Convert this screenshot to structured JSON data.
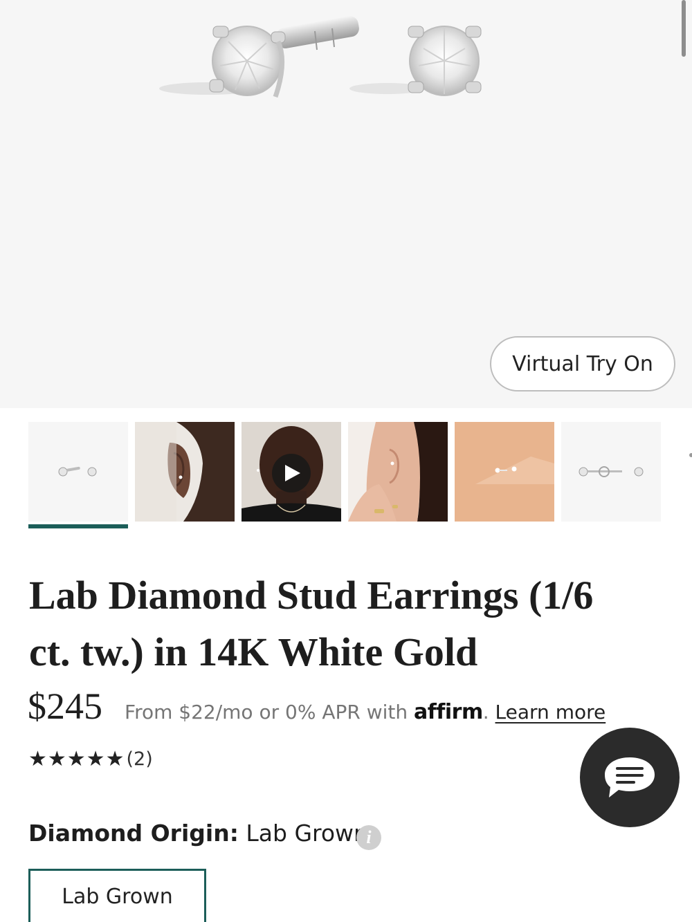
{
  "hero": {
    "image": "diamond-stud-earrings-product-photo",
    "virtual_try_on_label": "Virtual Try On"
  },
  "thumbnails": [
    {
      "name": "studs-front-view",
      "selected": true
    },
    {
      "name": "ear-side-view-model",
      "selected": false
    },
    {
      "name": "model-face-video",
      "selected": false,
      "video": true
    },
    {
      "name": "ear-hand-model",
      "selected": false
    },
    {
      "name": "studs-on-peach-background",
      "selected": false
    },
    {
      "name": "studs-with-backs",
      "selected": false
    }
  ],
  "product": {
    "title": "Lab Diamond Stud Earrings (1/6 ct. tw.) in 14K White Gold",
    "price": "$245",
    "financing_text": "From $22/mo or 0% APR with",
    "affirm_logo": "affirm",
    "financing_period": ".",
    "learn_more": "Learn more",
    "rating_stars": "★★★★★",
    "rating_value": 5,
    "review_count": "(2)"
  },
  "options": {
    "diamond_origin_label": "Diamond Origin:",
    "diamond_origin_value": "Lab Grown",
    "choices": [
      "Lab Grown"
    ]
  },
  "colors": {
    "accent_teal": "#1c5e59",
    "hero_bg": "#f6f6f6",
    "chat_bg": "#2b2b2b"
  },
  "icons": [
    "info-icon",
    "chat-icon",
    "play-icon"
  ]
}
